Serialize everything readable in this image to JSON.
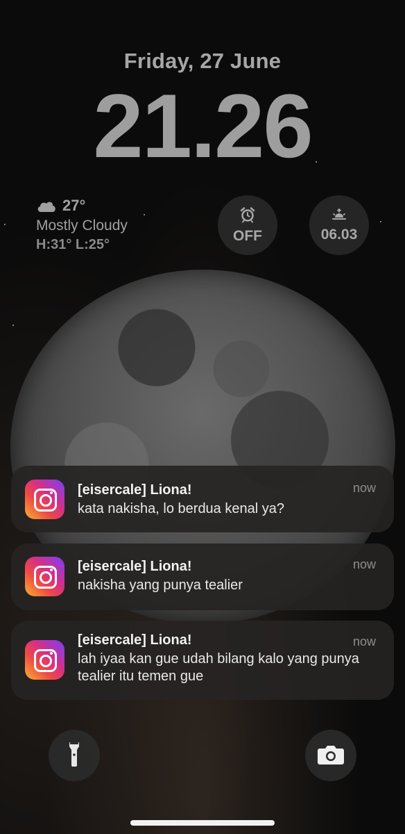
{
  "lockscreen": {
    "date": "Friday, 27 June",
    "time": "21.26"
  },
  "weather": {
    "icon": "cloud-icon",
    "temperature": "27°",
    "condition": "Mostly Cloudy",
    "high_low": "H:31° L:25°"
  },
  "widgets": {
    "alarm": {
      "icon": "alarm-clock-icon",
      "label": "OFF"
    },
    "sunrise": {
      "icon": "sunrise-icon",
      "label": "06.03"
    }
  },
  "notifications": [
    {
      "app": "Instagram",
      "icon": "instagram-icon",
      "title": "[eisercale] Liona!",
      "body": "kata nakisha, lo berdua kenal ya?",
      "time": "now"
    },
    {
      "app": "Instagram",
      "icon": "instagram-icon",
      "title": "[eisercale] Liona!",
      "body": "nakisha yang punya tealier",
      "time": "now"
    },
    {
      "app": "Instagram",
      "icon": "instagram-icon",
      "title": "[eisercale] Liona!",
      "body": "lah iyaa kan gue udah bilang kalo yang punya tealier itu temen gue",
      "time": "now"
    }
  ],
  "bottom": {
    "left_icon": "flashlight-icon",
    "right_icon": "camera-icon"
  },
  "colors": {
    "background": "#0b0b0b",
    "clock_text": "#9e9e9e",
    "notification_bg": "#262423"
  }
}
